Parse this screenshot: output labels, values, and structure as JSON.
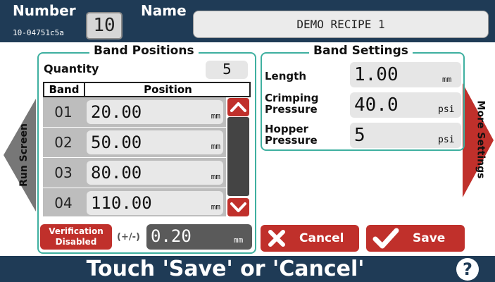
{
  "header": {
    "number_label": "Number",
    "serial": "10-04751c5a",
    "number_value": "10",
    "name_label": "Name",
    "name_value": "DEMO RECIPE 1"
  },
  "left_nav": {
    "label": "Run Screen"
  },
  "right_nav": {
    "label": "More Settings"
  },
  "band_positions": {
    "title": "Band Positions",
    "quantity_label": "Quantity",
    "quantity_value": "5",
    "col_band": "Band",
    "col_position": "Position",
    "rows": [
      {
        "band": "01",
        "position": "20.00",
        "unit": "mm"
      },
      {
        "band": "02",
        "position": "50.00",
        "unit": "mm"
      },
      {
        "band": "03",
        "position": "80.00",
        "unit": "mm"
      },
      {
        "band": "04",
        "position": "110.00",
        "unit": "mm"
      }
    ],
    "verification": {
      "line1": "Verification",
      "line2": "Disabled"
    },
    "tolerance_label": "(+/-)",
    "tolerance_value": "0.20",
    "tolerance_unit": "mm"
  },
  "band_settings": {
    "title": "Band Settings",
    "length": {
      "label": "Length",
      "value": "1.00",
      "unit": "mm"
    },
    "crimping": {
      "label1": "Crimping",
      "label2": "Pressure",
      "value": "40.0",
      "unit": "psi"
    },
    "hopper": {
      "label1": "Hopper",
      "label2": "Pressure",
      "value": "5",
      "unit": "psi"
    }
  },
  "actions": {
    "cancel_label": "Cancel",
    "save_label": "Save"
  },
  "status": {
    "message": "Touch 'Save' or 'Cancel'",
    "help_glyph": "?"
  },
  "colors": {
    "navy": "#1f3b56",
    "accent_red": "#c0302b",
    "group_border": "#3fb0a0"
  },
  "icons": [
    "left-arrow-icon",
    "right-arrow-icon",
    "scroll-up-icon",
    "scroll-down-icon",
    "x-icon",
    "check-icon",
    "help-icon"
  ]
}
